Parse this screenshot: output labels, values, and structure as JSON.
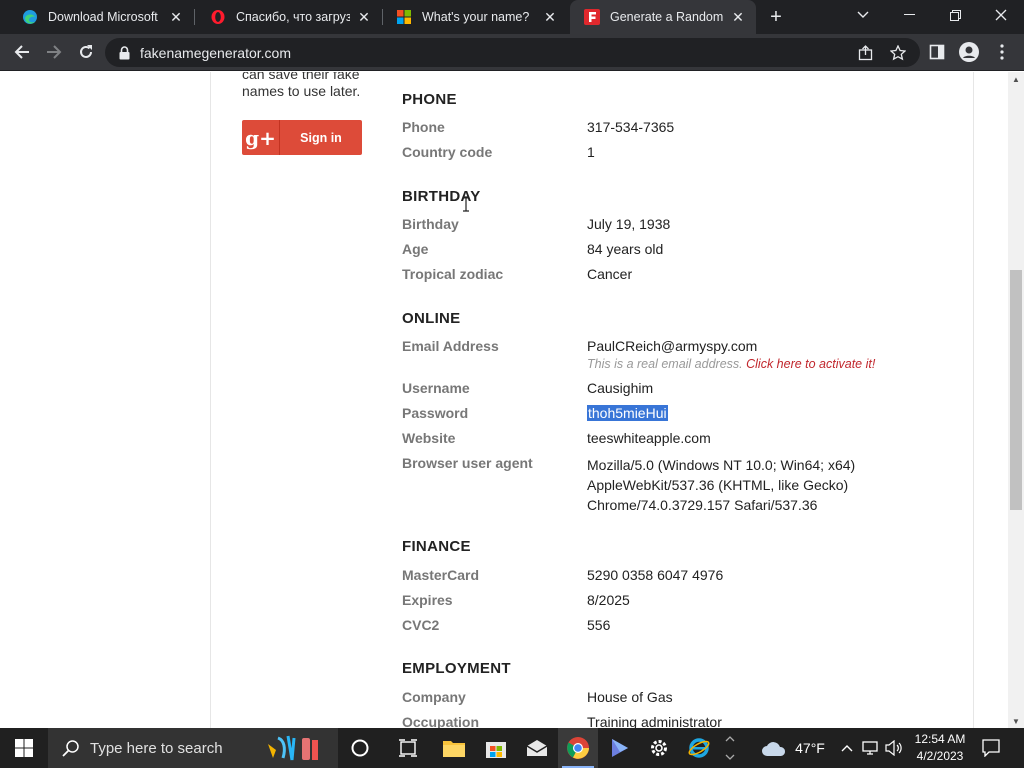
{
  "browser": {
    "tabs": [
      {
        "title": "Download Microsoft Ec",
        "icon": "edge-icon"
      },
      {
        "title": "Спасибо, что загрузил",
        "icon": "opera-icon"
      },
      {
        "title": "What's your name?",
        "icon": "microsoft-icon"
      },
      {
        "title": "Generate a Random N",
        "icon": "fakename-icon"
      }
    ],
    "url": "fakenamegenerator.com"
  },
  "sidebar": {
    "text_line1": "can save their fake",
    "text_line2": "names to use later.",
    "gplus_label": "Sign in"
  },
  "phone": {
    "heading": "PHONE",
    "phone_label": "Phone",
    "phone_value": "317-534-7365",
    "cc_label": "Country code",
    "cc_value": "1"
  },
  "birthday": {
    "heading": "BIRTHDAY",
    "bday_label": "Birthday",
    "bday_value": "July 19, 1938",
    "age_label": "Age",
    "age_value": "84 years old",
    "zodiac_label": "Tropical zodiac",
    "zodiac_value": "Cancer"
  },
  "online": {
    "heading": "ONLINE",
    "email_label": "Email Address",
    "email_value": "PaulCReich@armyspy.com",
    "email_note": "This is a real email address.",
    "email_link": "Click here to activate it!",
    "user_label": "Username",
    "user_value": "Causighim",
    "pass_label": "Password",
    "pass_value": "thoh5mieHui",
    "web_label": "Website",
    "web_value": "teeswhiteapple.com",
    "ua_label": "Browser user agent",
    "ua_line1": "Mozilla/5.0 (Windows NT 10.0; Win64; x64)",
    "ua_line2": "AppleWebKit/537.36 (KHTML, like Gecko)",
    "ua_line3": "Chrome/74.0.3729.157 Safari/537.36"
  },
  "finance": {
    "heading": "FINANCE",
    "card_label": "MasterCard",
    "card_value": "5290 0358 6047 4976",
    "exp_label": "Expires",
    "exp_value": "8/2025",
    "cvc_label": "CVC2",
    "cvc_value": "556"
  },
  "employment": {
    "heading": "EMPLOYMENT",
    "company_label": "Company",
    "company_value": "House of Gas",
    "occ_label": "Occupation",
    "occ_value": "Training administrator"
  },
  "taskbar": {
    "search_placeholder": "Type here to search",
    "temperature": "47°F",
    "time": "12:54 AM",
    "date": "4/2/2023"
  }
}
